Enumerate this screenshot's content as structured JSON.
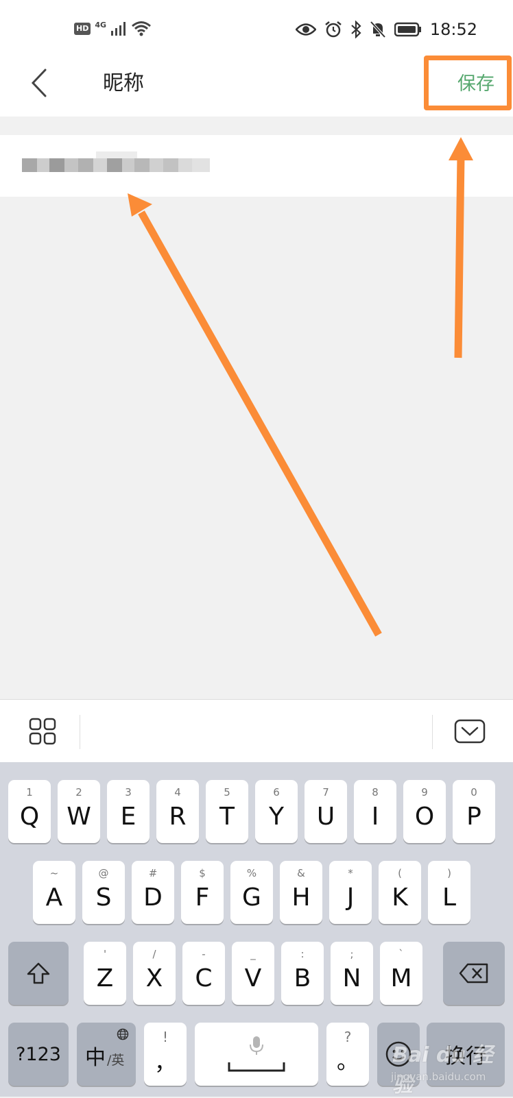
{
  "status_bar": {
    "hd": "HD",
    "network": "4G",
    "time": "18:52"
  },
  "header": {
    "title": "昵称",
    "save_label": "保存"
  },
  "nickname_input": {
    "value_obscured": true
  },
  "keyboard": {
    "row1": [
      {
        "sec": "1",
        "pri": "Q"
      },
      {
        "sec": "2",
        "pri": "W"
      },
      {
        "sec": "3",
        "pri": "E"
      },
      {
        "sec": "4",
        "pri": "R"
      },
      {
        "sec": "5",
        "pri": "T"
      },
      {
        "sec": "6",
        "pri": "Y"
      },
      {
        "sec": "7",
        "pri": "U"
      },
      {
        "sec": "8",
        "pri": "I"
      },
      {
        "sec": "9",
        "pri": "O"
      },
      {
        "sec": "0",
        "pri": "P"
      }
    ],
    "row2": [
      {
        "sec": "~",
        "pri": "A"
      },
      {
        "sec": "@",
        "pri": "S"
      },
      {
        "sec": "#",
        "pri": "D"
      },
      {
        "sec": "$",
        "pri": "F"
      },
      {
        "sec": "%",
        "pri": "G"
      },
      {
        "sec": "&",
        "pri": "H"
      },
      {
        "sec": "*",
        "pri": "J"
      },
      {
        "sec": "(",
        "pri": "K"
      },
      {
        "sec": ")",
        "pri": "L"
      }
    ],
    "row3": [
      {
        "sec": "'",
        "pri": "Z"
      },
      {
        "sec": "/",
        "pri": "X"
      },
      {
        "sec": "-",
        "pri": "C"
      },
      {
        "sec": "_",
        "pri": "V"
      },
      {
        "sec": ":",
        "pri": "B"
      },
      {
        "sec": ";",
        "pri": "N"
      },
      {
        "sec": "`",
        "pri": "M"
      }
    ],
    "symbols_label": "?123",
    "lang_label": "中",
    "lang_alt_label": "/英",
    "comma_sec": "!",
    "comma_pri": "，",
    "period_sec": "?",
    "period_pri": "。",
    "enter_label": "换行"
  },
  "watermark": {
    "logo": "Bai du 经验",
    "url": "jingyan.baidu.com"
  },
  "colors": {
    "accent_save": "#57a86f",
    "annotation": "#fb8c37",
    "keyboard_bg": "#d3d6de"
  }
}
